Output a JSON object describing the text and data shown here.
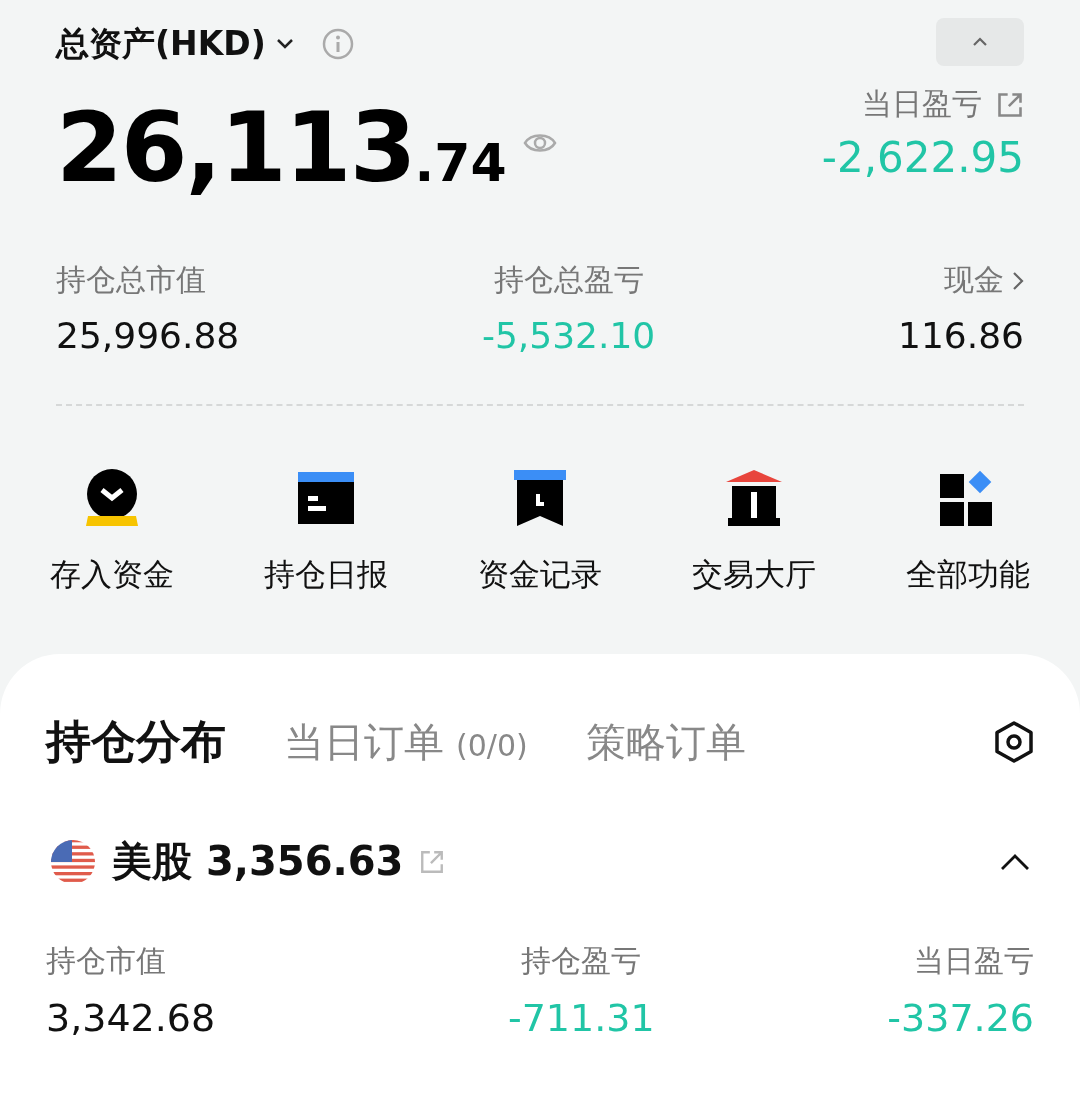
{
  "summary": {
    "title": "总资产(HKD)",
    "total_integer": "26,113",
    "total_decimal": ".74",
    "daily_pl_label": "当日盈亏",
    "daily_pl_value": "-2,622.95"
  },
  "stats": [
    {
      "label": "持仓总市值",
      "value": "25,996.88",
      "color": "#111111",
      "link": false
    },
    {
      "label": "持仓总盈亏",
      "value": "-5,532.10",
      "color": "#21c5a6",
      "link": false
    },
    {
      "label": "现金",
      "value": "116.86",
      "color": "#111111",
      "link": true
    }
  ],
  "shortcuts": [
    {
      "kind": "deposit",
      "label": "存入资金"
    },
    {
      "kind": "report",
      "label": "持仓日报"
    },
    {
      "kind": "record",
      "label": "资金记录"
    },
    {
      "kind": "hall",
      "label": "交易大厅"
    },
    {
      "kind": "all",
      "label": "全部功能"
    }
  ],
  "tabs": [
    {
      "label": "持仓分布",
      "selected": true
    },
    {
      "label": "当日订单",
      "count": "(0/0)",
      "selected": false
    },
    {
      "label": "策略订单",
      "selected": false
    }
  ],
  "market": {
    "name": "美股",
    "value": "3,356.63",
    "expanded": true,
    "metrics": [
      {
        "label": "持仓市值",
        "value": "3,342.68",
        "color": "#111111"
      },
      {
        "label": "持仓盈亏",
        "value": "-711.31",
        "color": "#21c5a6"
      },
      {
        "label": "当日盈亏",
        "value": "-337.26",
        "color": "#21c5a6"
      }
    ]
  }
}
